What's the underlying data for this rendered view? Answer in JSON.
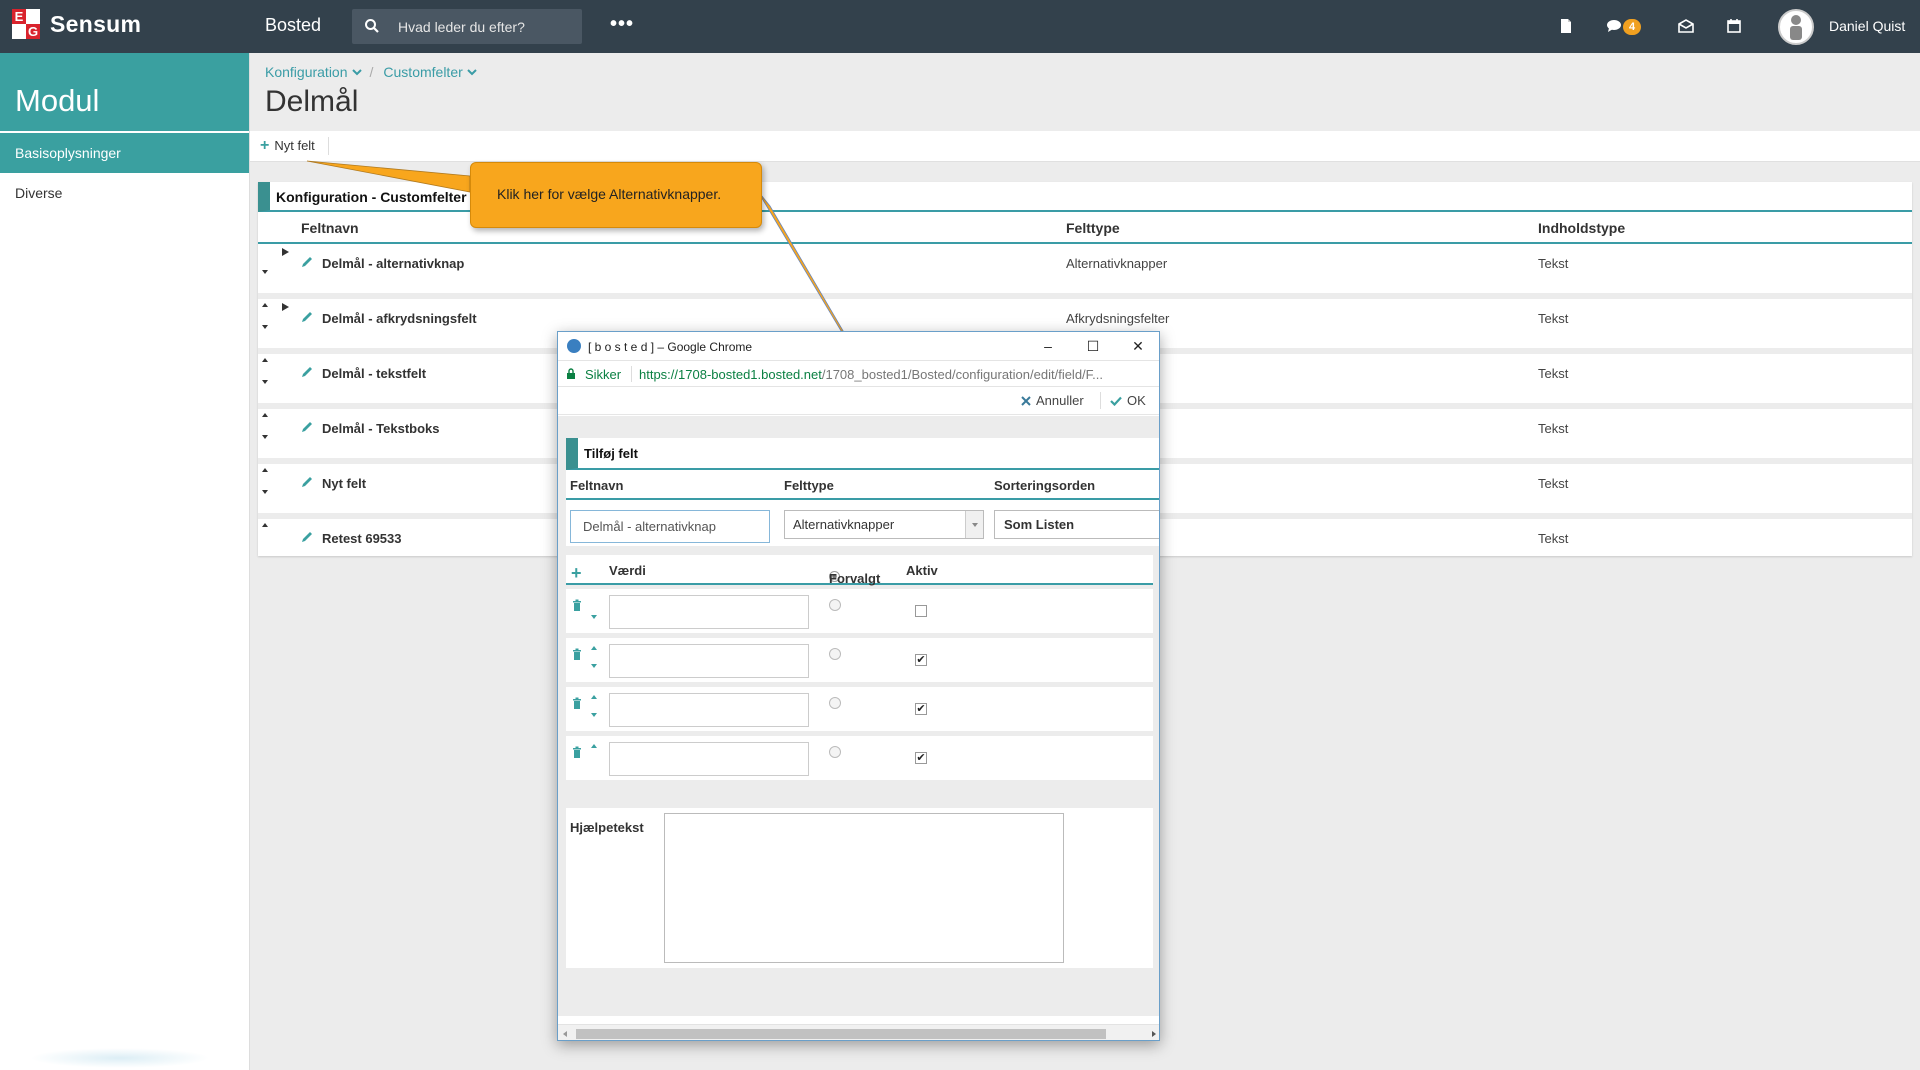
{
  "topbar": {
    "brand_e": "E",
    "brand_g": "G",
    "brand": "Sensum",
    "app_name": "Bosted",
    "search_placeholder": "Hvad leder du efter?",
    "more": "•••",
    "messages_badge": "4",
    "user_name": "Daniel Quist"
  },
  "sidebar": {
    "title": "Modul",
    "items": [
      {
        "label": "Basisoplysninger",
        "active": true
      },
      {
        "label": "Diverse",
        "active": false
      }
    ]
  },
  "header": {
    "breadcrumb": [
      "Konfiguration",
      "Customfelter"
    ],
    "title": "Delmål"
  },
  "toolbar": {
    "new_field": "Nyt felt"
  },
  "panel": {
    "title": "Konfiguration - Customfelter",
    "columns": {
      "name": "Feltnavn",
      "type": "Felttype",
      "content": "Indholdstype"
    },
    "rows": [
      {
        "name": "Delmål - alternativknap",
        "type": "Alternativknapper",
        "content": "Tekst"
      },
      {
        "name": "Delmål - afkrydsningsfelt",
        "type": "Afkrydsningsfelter",
        "content": "Tekst"
      },
      {
        "name": "Delmål - tekstfelt",
        "type": "",
        "content": "Tekst"
      },
      {
        "name": "Delmål - Tekstboks",
        "type": "",
        "content": "Tekst"
      },
      {
        "name": "Nyt felt",
        "type": "",
        "content": "Tekst"
      },
      {
        "name": "Retest 69533",
        "type": "",
        "content": "Tekst"
      }
    ]
  },
  "popup": {
    "window_title": "[ b o s t e d ] – Google Chrome",
    "secure_label": "Sikker",
    "url_host": "https://1708-bosted1.bosted.net",
    "url_rest": "/1708_bosted1/Bosted/configuration/edit/field/F...",
    "cancel": "Annuller",
    "ok": "OK",
    "section_title": "Tilføj felt",
    "fields": {
      "name_label": "Feltnavn",
      "type_label": "Felttype",
      "sort_label": "Sorteringsorden",
      "name_value": "Delmål - alternativknap",
      "type_value": "Alternativknapper",
      "sort_value": "Som Listen"
    },
    "values": {
      "value_label": "Værdi",
      "default_label": "Forvalgt",
      "active_label": "Aktiv",
      "rows": [
        {
          "active": false
        },
        {
          "active": true
        },
        {
          "active": true
        },
        {
          "active": true
        }
      ]
    },
    "help_label": "Hjælpetekst"
  },
  "callout": {
    "text": "Klik her for vælge Alternativknapper."
  },
  "colors": {
    "topbar": "#33414c",
    "accent": "#3aa0a0",
    "callout": "#f8a61d"
  }
}
